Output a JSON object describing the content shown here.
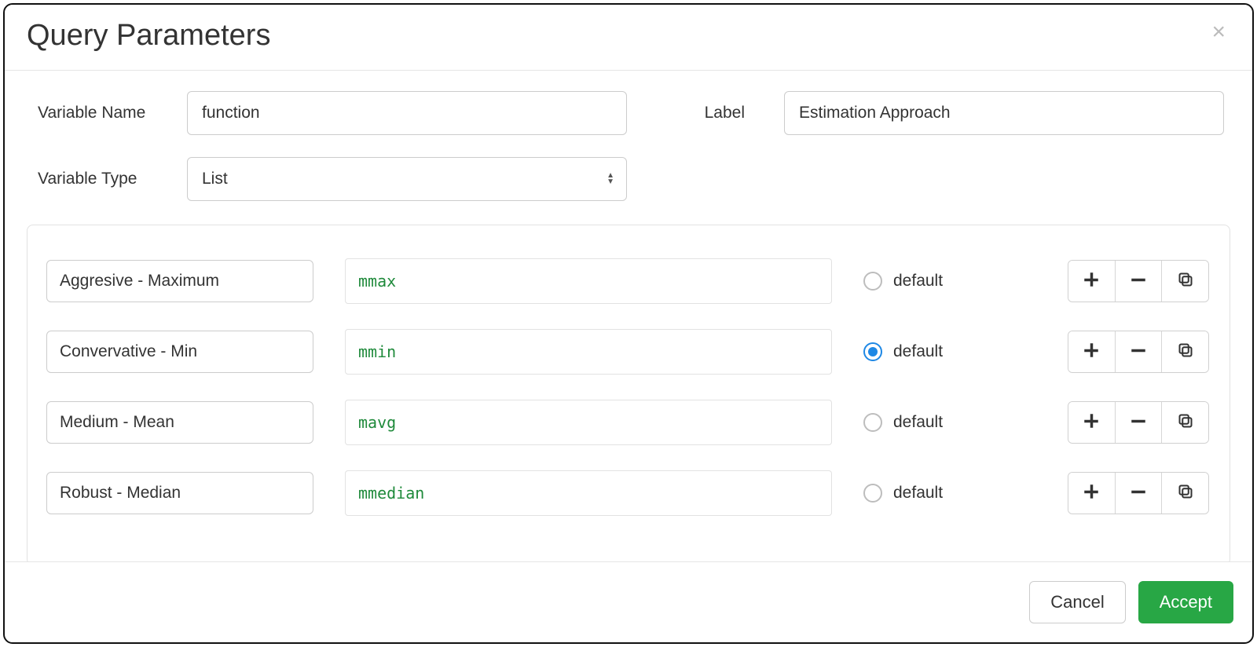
{
  "modal": {
    "title": "Query Parameters",
    "close_icon": "×"
  },
  "form": {
    "variable_name_label": "Variable Name",
    "variable_name_value": "function",
    "label_label": "Label",
    "label_value": "Estimation Approach",
    "variable_type_label": "Variable Type",
    "variable_type_value": "List"
  },
  "list_items": [
    {
      "display": "Aggresive - Maximum",
      "value": "mmax",
      "default": false,
      "default_label": "default"
    },
    {
      "display": "Convervative - Min",
      "value": "mmin",
      "default": true,
      "default_label": "default"
    },
    {
      "display": "Medium - Mean",
      "value": "mavg",
      "default": false,
      "default_label": "default"
    },
    {
      "display": "Robust - Median",
      "value": "mmedian",
      "default": false,
      "default_label": "default"
    }
  ],
  "footer": {
    "cancel": "Cancel",
    "accept": "Accept"
  }
}
